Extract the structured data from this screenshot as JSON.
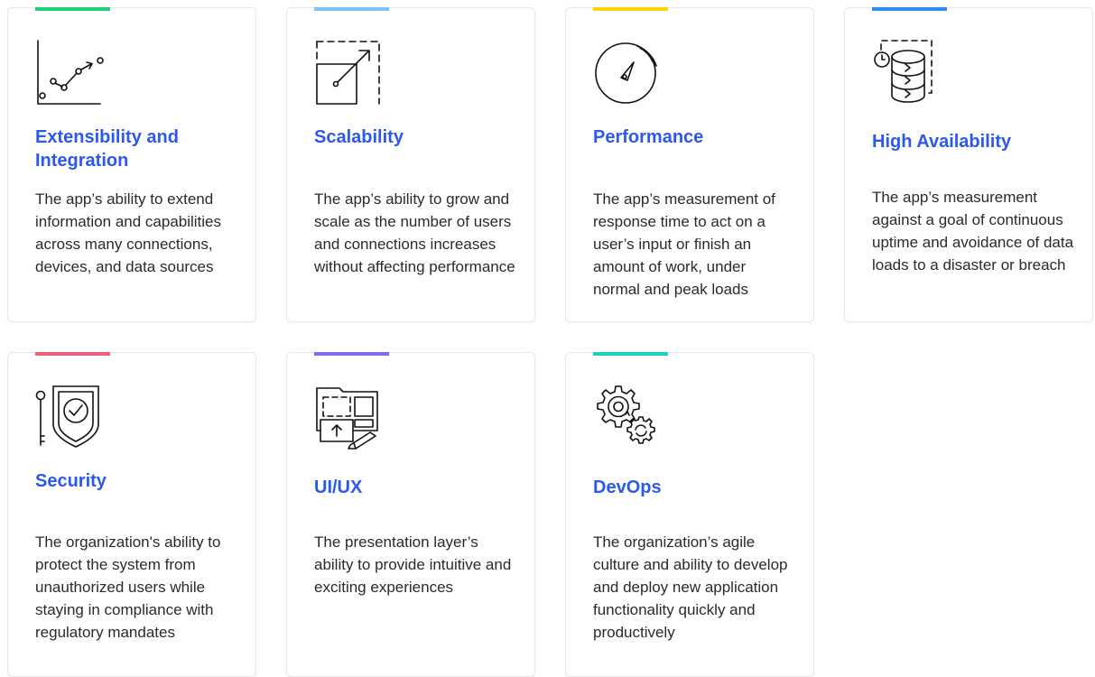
{
  "cards": [
    {
      "title": "Extensibility and Integration",
      "description": "The app’s ability to extend information and capabilities across many connections, devices, and data sources",
      "accent": "#1fd07a",
      "icon": "line-chart-icon"
    },
    {
      "title": "Scalability",
      "description": "The app’s ability to grow and scale as the number of users and connections increases without affecting performance",
      "accent": "#7ec3f7",
      "icon": "scale-up-icon"
    },
    {
      "title": "Performance",
      "description": "The app’s measurement of response time to act on a user’s input or finish an amount of work, under normal and peak loads",
      "accent": "#ffd400",
      "icon": "speedometer-icon"
    },
    {
      "title": "High Availability",
      "description": "The app’s measurement against a goal of continuous uptime and avoidance of data loads to a disaster or breach",
      "accent": "#2f8df0",
      "icon": "database-clock-icon"
    },
    {
      "title": "Security",
      "description": "The organization's ability to protect the system from unauthorized users while staying in compliance with regulatory mandates",
      "accent": "#f0607a",
      "icon": "shield-key-icon"
    },
    {
      "title": "UI/UX",
      "description": "The presentation layer’s ability to provide intuitive and exciting experiences",
      "accent": "#7b6cf0",
      "icon": "design-layout-icon"
    },
    {
      "title": "DevOps",
      "description": "The organization’s agile culture and ability to develop and deploy new application functionality quickly and productively",
      "accent": "#1fd0c4",
      "icon": "gears-cycle-icon"
    }
  ]
}
